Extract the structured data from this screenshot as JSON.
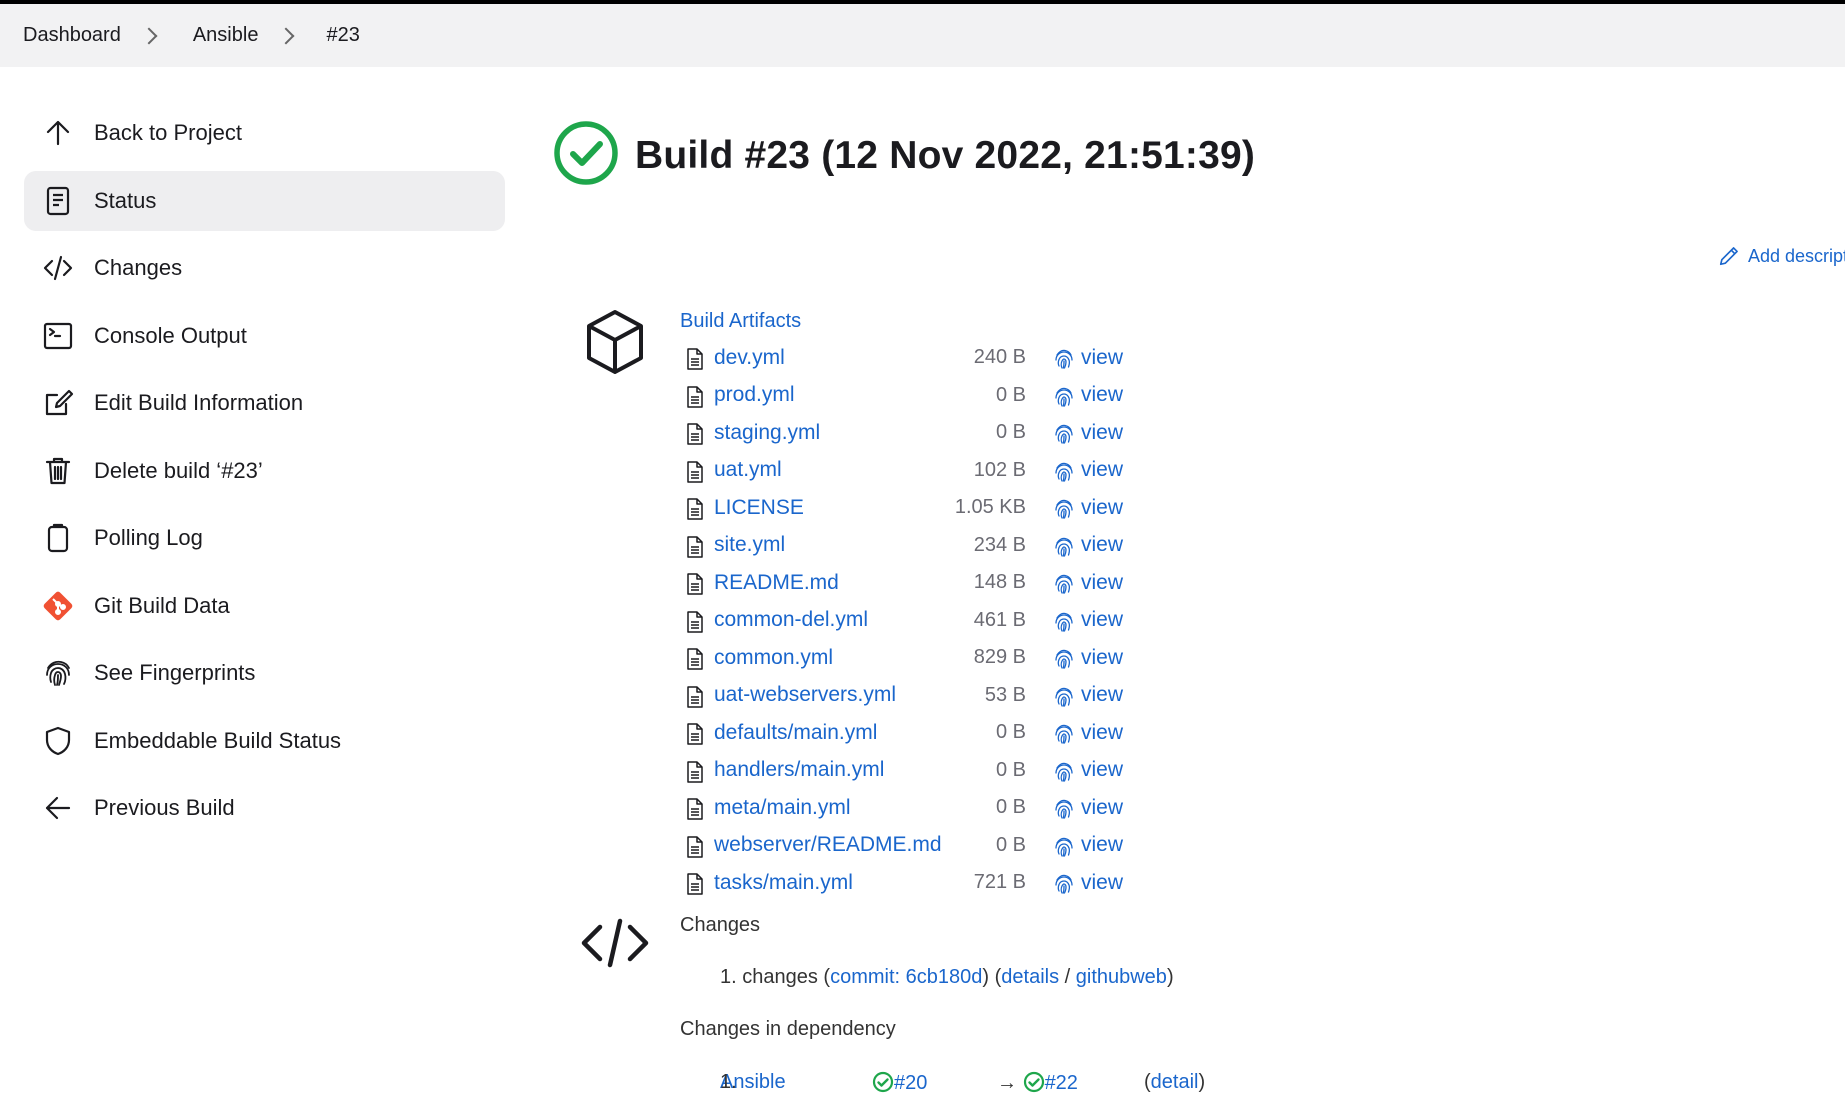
{
  "breadcrumb": [
    "Dashboard",
    "Ansible",
    "#23"
  ],
  "sidebar": {
    "items": [
      {
        "label": "Back to Project",
        "icon": "arrow-up-icon"
      },
      {
        "label": "Status",
        "icon": "document-icon",
        "active": true
      },
      {
        "label": "Changes",
        "icon": "code-icon"
      },
      {
        "label": "Console Output",
        "icon": "terminal-icon"
      },
      {
        "label": "Edit Build Information",
        "icon": "edit-icon"
      },
      {
        "label": "Delete build ‘#23’",
        "icon": "trash-icon"
      },
      {
        "label": "Polling Log",
        "icon": "clipboard-icon"
      },
      {
        "label": "Git Build Data",
        "icon": "git-icon"
      },
      {
        "label": "See Fingerprints",
        "icon": "fingerprint-icon"
      },
      {
        "label": "Embeddable Build Status",
        "icon": "shield-icon"
      },
      {
        "label": "Previous Build",
        "icon": "arrow-left-icon"
      }
    ]
  },
  "build": {
    "title": "Build #23 (12 Nov 2022, 21:51:39)",
    "status_color": "#1ea64b",
    "add_description": "Add descript"
  },
  "artifacts": {
    "title": "Build Artifacts",
    "view_label": "view",
    "files": [
      {
        "name": "dev.yml",
        "size": "240 B"
      },
      {
        "name": "prod.yml",
        "size": "0 B"
      },
      {
        "name": "staging.yml",
        "size": "0 B"
      },
      {
        "name": "uat.yml",
        "size": "102 B"
      },
      {
        "name": "LICENSE",
        "size": "1.05 KB"
      },
      {
        "name": "site.yml",
        "size": "234 B"
      },
      {
        "name": "README.md",
        "size": "148 B"
      },
      {
        "name": "common-del.yml",
        "size": "461 B"
      },
      {
        "name": "common.yml",
        "size": "829 B"
      },
      {
        "name": "uat-webservers.yml",
        "size": "53 B"
      },
      {
        "name": "defaults/main.yml",
        "size": "0 B"
      },
      {
        "name": "handlers/main.yml",
        "size": "0 B"
      },
      {
        "name": "meta/main.yml",
        "size": "0 B"
      },
      {
        "name": "webserver/README.md",
        "size": "0 B"
      },
      {
        "name": "tasks/main.yml",
        "size": "721 B"
      }
    ]
  },
  "changes": {
    "title": "Changes",
    "item_prefix": "1. changes (",
    "commit": "commit: 6cb180d",
    "mid": ") (",
    "details": "details",
    "slash": " / ",
    "githubweb": "githubweb",
    "close": ")"
  },
  "dependency": {
    "title": "Changes in dependency",
    "num": "1.",
    "project": "Ansible",
    "from": "#20",
    "arrow": "→",
    "to": "#22",
    "open": "(",
    "detail": "detail",
    "close": ")"
  },
  "colors": {
    "link": "#1a66cc",
    "success": "#1ea64b"
  }
}
